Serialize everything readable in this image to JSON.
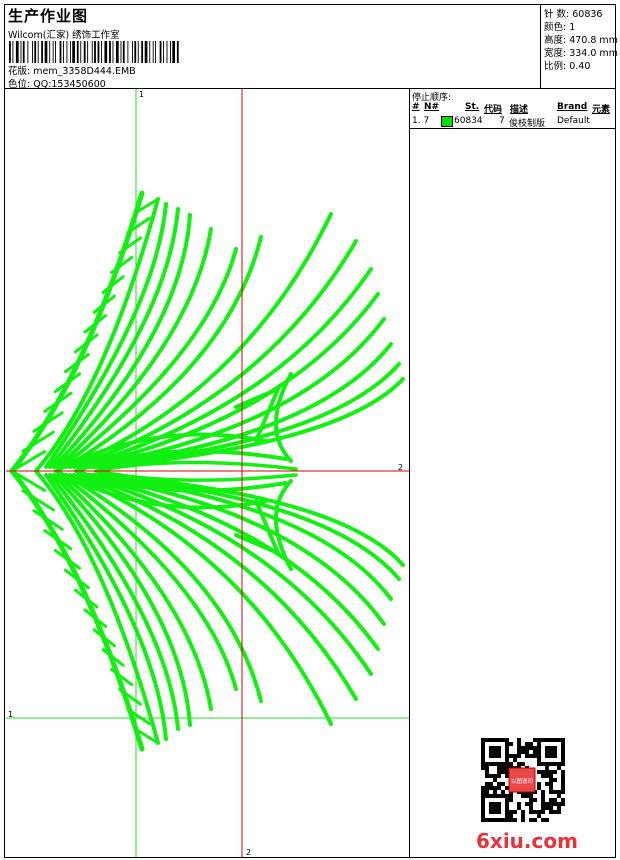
{
  "header": {
    "title": "生产作业图",
    "subtitle": "Wilcom(汇家) 绣饰工作室",
    "design_label": "花版:",
    "design_file": "mem_3358D444.EMB",
    "color_label": "色位:",
    "color_value": "QQ:153450600"
  },
  "stats": {
    "stitches": "针 数: 60836",
    "colors": "颜色: 1",
    "height": "高度: 470.8 mm",
    "width": "宽度: 334.0 mm",
    "scale": "比例: 0.40"
  },
  "stop_panel": {
    "title": "停止顺序:",
    "columns": {
      "num": "#",
      "n": "N#",
      "st": "St.",
      "code": "代码",
      "desc": "描述",
      "brand": "Brand",
      "element": "元素"
    },
    "rows": [
      {
        "num": "1. 7",
        "st": "60834",
        "code": "7",
        "desc": "俊枝制版",
        "brand": "Default",
        "color": "#00e000"
      }
    ]
  },
  "canvas": {
    "axis_green_v": "1",
    "axis_green_h": "1",
    "axis_red_v": "2",
    "axis_red_h": "2",
    "thread_color": "#11f011",
    "axis_green_color": "#20e020",
    "axis_red_color": "#e00000"
  },
  "watermark": {
    "logo": "6xiu.com",
    "stamp": "以图速印"
  }
}
